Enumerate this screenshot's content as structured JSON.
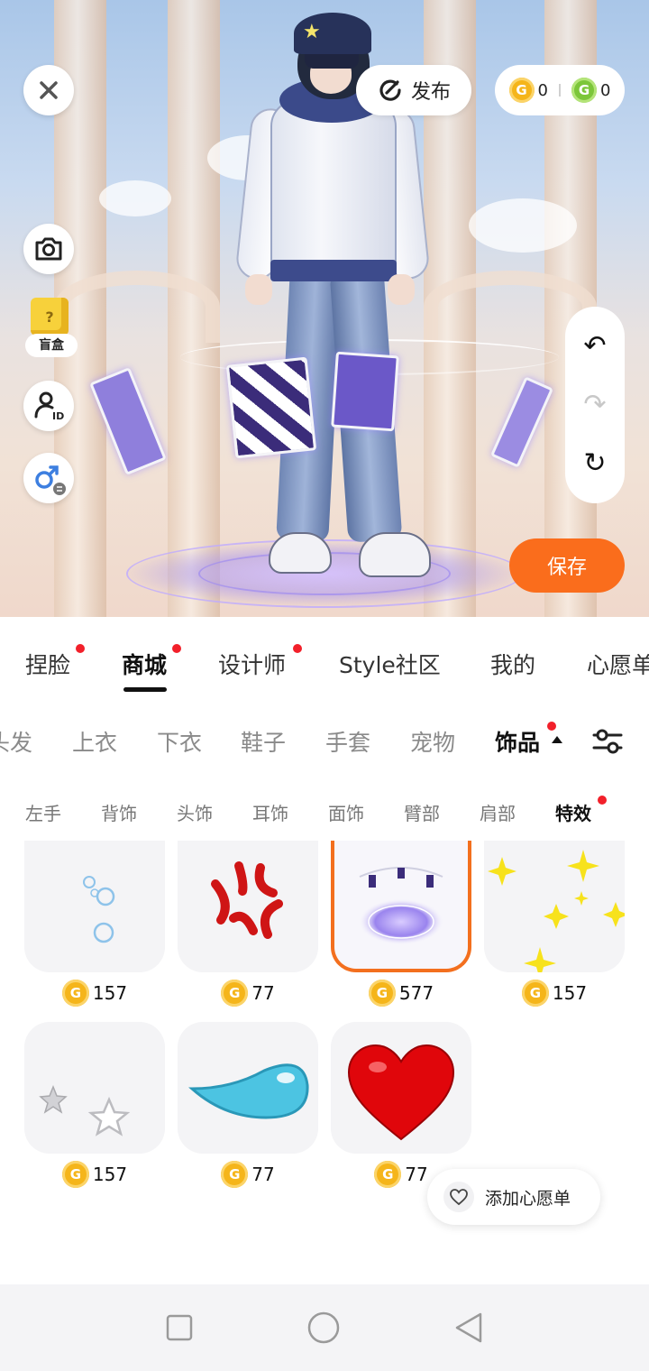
{
  "top": {
    "publish_label": "发布",
    "coins": {
      "gold": "0",
      "green": "0"
    },
    "save_label": "保存",
    "blindbox_label": "盲盒"
  },
  "main_tabs": [
    "捏脸",
    "商城",
    "设计师",
    "Style社区",
    "我的",
    "心愿单"
  ],
  "main_tab_active": "商城",
  "categories": [
    "头发",
    "上衣",
    "下衣",
    "鞋子",
    "手套",
    "宠物",
    "饰品"
  ],
  "category_active": "饰品",
  "subcategories": [
    "左手",
    "背饰",
    "头饰",
    "耳饰",
    "面饰",
    "臂部",
    "肩部",
    "特效"
  ],
  "subcategory_active": "特效",
  "items": [
    {
      "name": "bubbles",
      "price": "157",
      "selected": false
    },
    {
      "name": "anger-mark",
      "price": "77",
      "selected": false
    },
    {
      "name": "magic-circle",
      "price": "577",
      "selected": true
    },
    {
      "name": "sparkles",
      "price": "157",
      "selected": false
    },
    {
      "name": "stars",
      "price": "157",
      "selected": false
    },
    {
      "name": "water-drop",
      "price": "77",
      "selected": false
    },
    {
      "name": "red-heart",
      "price": "77",
      "selected": false
    }
  ],
  "wishlist_button": "添加心愿单",
  "colors": {
    "accent": "#fa6d1c",
    "badge": "#f2202a",
    "coin_gold": "#f5b51a",
    "coin_green": "#7cc63a"
  },
  "icons": [
    "close-icon",
    "camera-icon",
    "publish-icon",
    "undo-icon",
    "redo-icon",
    "reset-icon",
    "id-icon",
    "gender-swap-icon",
    "filter-icon",
    "heart-icon"
  ]
}
